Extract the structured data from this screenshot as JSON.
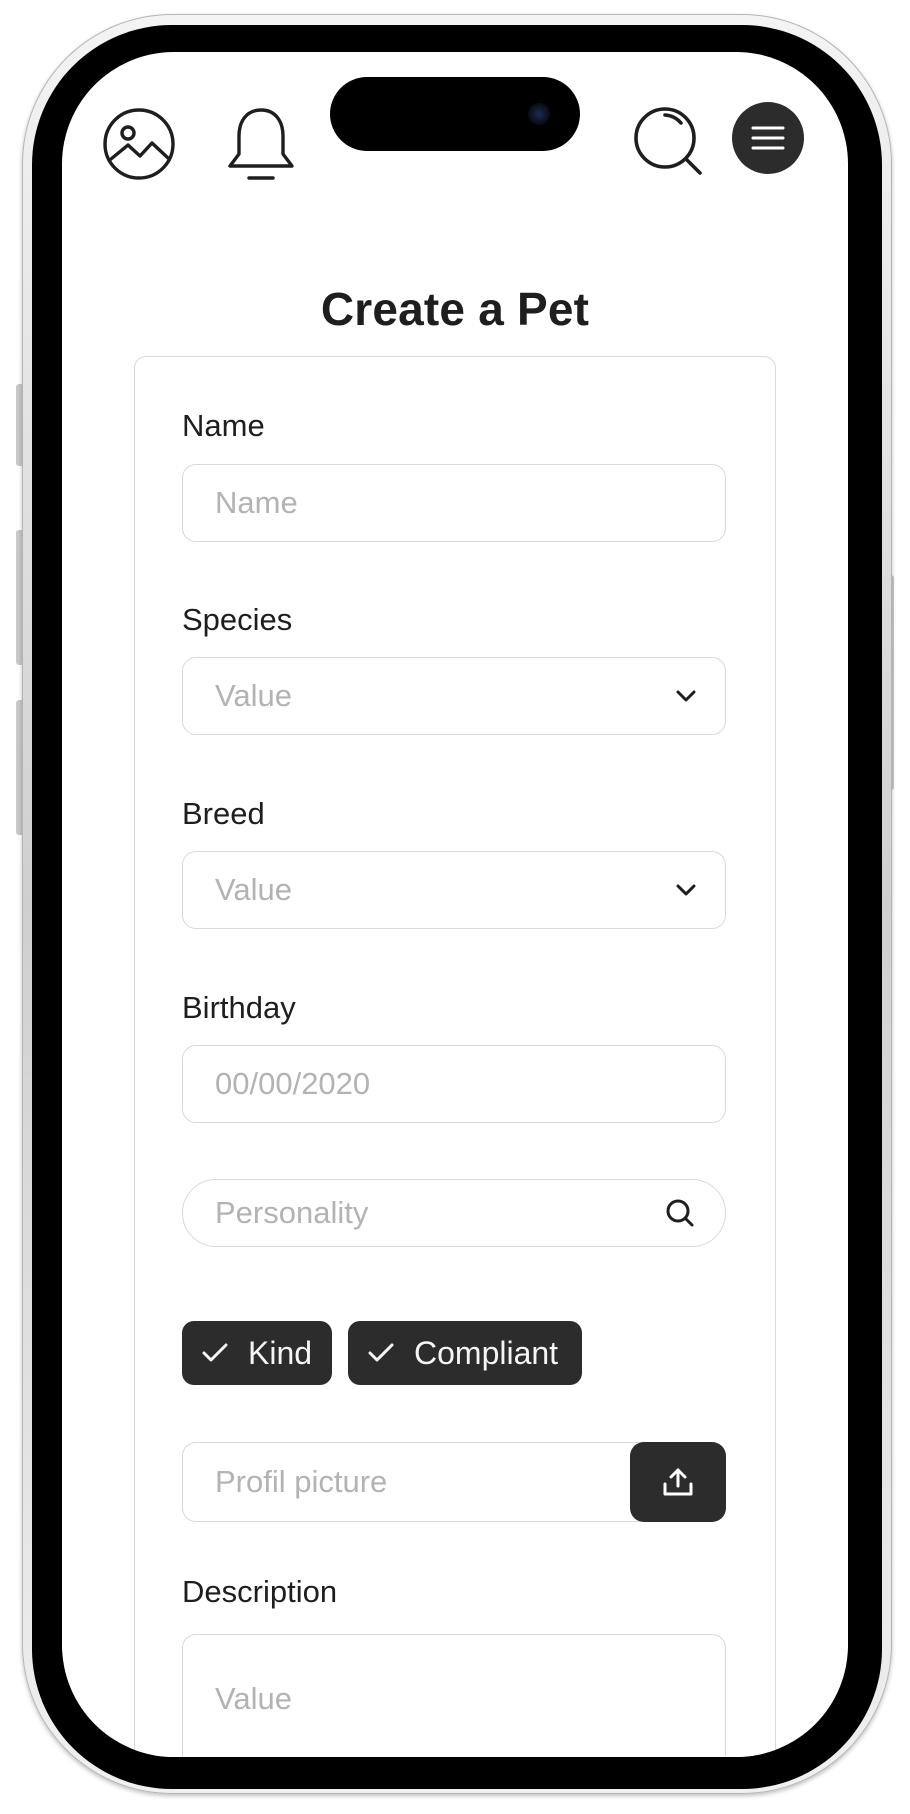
{
  "header": {
    "icons": [
      "image-icon",
      "bell-icon",
      "search-icon",
      "menu-icon"
    ]
  },
  "page": {
    "title": "Create a Pet"
  },
  "form": {
    "name": {
      "label": "Name",
      "placeholder": "Name"
    },
    "species": {
      "label": "Species",
      "placeholder": "Value"
    },
    "breed": {
      "label": "Breed",
      "placeholder": "Value"
    },
    "birthday": {
      "label": "Birthday",
      "placeholder": "00/00/2020"
    },
    "personality": {
      "placeholder": "Personality",
      "chips": [
        {
          "label": "Kind",
          "selected": true
        },
        {
          "label": "Compliant",
          "selected": true
        }
      ]
    },
    "profile_picture": {
      "placeholder": "Profil picture"
    },
    "description": {
      "label": "Description",
      "placeholder": "Value"
    }
  },
  "colors": {
    "primary_dark": "#2c2c2c",
    "border": "#d9d9d9",
    "placeholder": "#b3b3b3",
    "text": "#1e1e1e"
  }
}
